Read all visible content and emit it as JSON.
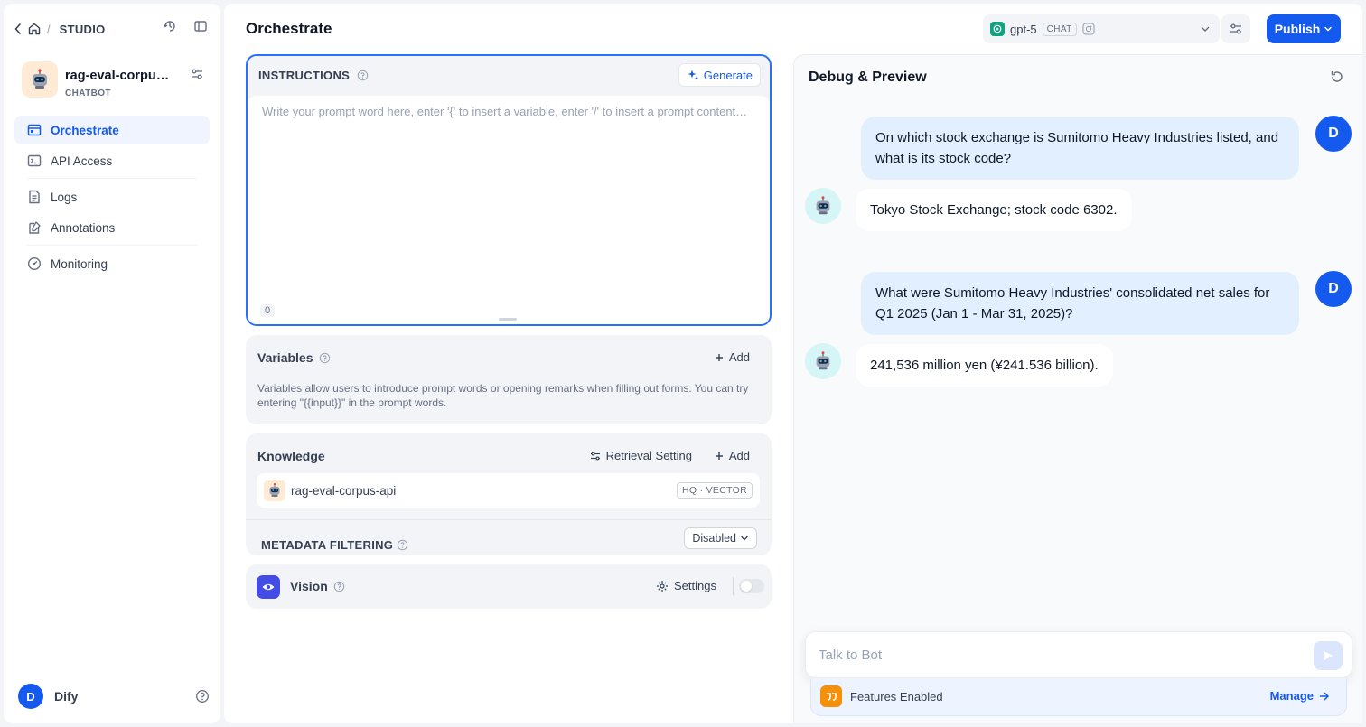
{
  "breadcrumb": {
    "section": "STUDIO",
    "separator": "/"
  },
  "app": {
    "name": "rag-eval-corpus-api",
    "type": "CHATBOT"
  },
  "nav": {
    "orchestrate": "Orchestrate",
    "api_access": "API Access",
    "logs": "Logs",
    "annotations": "Annotations",
    "monitoring": "Monitoring"
  },
  "user": {
    "initial": "D",
    "workspace": "Dify"
  },
  "header": {
    "title": "Orchestrate",
    "publish": "Publish"
  },
  "model": {
    "name": "gpt-5",
    "mode_tag": "CHAT"
  },
  "instructions": {
    "title": "INSTRUCTIONS",
    "generate": "Generate",
    "placeholder": "Write your prompt word here, enter '{' to insert a variable, enter '/' to insert a prompt content block",
    "char_count": "0"
  },
  "variables": {
    "title": "Variables",
    "add": "Add",
    "description": "Variables allow users to introduce prompt words or opening remarks when filling out forms. You can try entering \"{{input}}\" in the prompt words."
  },
  "knowledge": {
    "title": "Knowledge",
    "retrieval_setting": "Retrieval Setting",
    "add": "Add",
    "items": [
      {
        "name": "rag-eval-corpus-api",
        "badge": "HQ · VECTOR"
      }
    ],
    "metadata_filtering": "METADATA FILTERING",
    "metadata_value": "Disabled"
  },
  "vision": {
    "title": "Vision",
    "settings": "Settings",
    "enabled": false
  },
  "debug": {
    "title": "Debug & Preview",
    "user_initial": "D",
    "messages": [
      {
        "role": "user",
        "text": "On which stock exchange is Sumitomo Heavy Industries listed, and what is its stock code?"
      },
      {
        "role": "bot",
        "text": "Tokyo Stock Exchange; stock code 6302."
      },
      {
        "role": "user",
        "text": "What were Sumitomo Heavy Industries' consolidated net sales for Q1 2025 (Jan 1 - Mar 31, 2025)?"
      },
      {
        "role": "bot",
        "text": "241,536 million yen (¥241.536 billion)."
      }
    ],
    "input_placeholder": "Talk to Bot",
    "features_label": "Features Enabled",
    "manage": "Manage"
  },
  "colors": {
    "accent": "#155aef",
    "vision_icon": "#444ce7",
    "feature_icon": "#f79009",
    "user_bubble": "#e1effe"
  }
}
